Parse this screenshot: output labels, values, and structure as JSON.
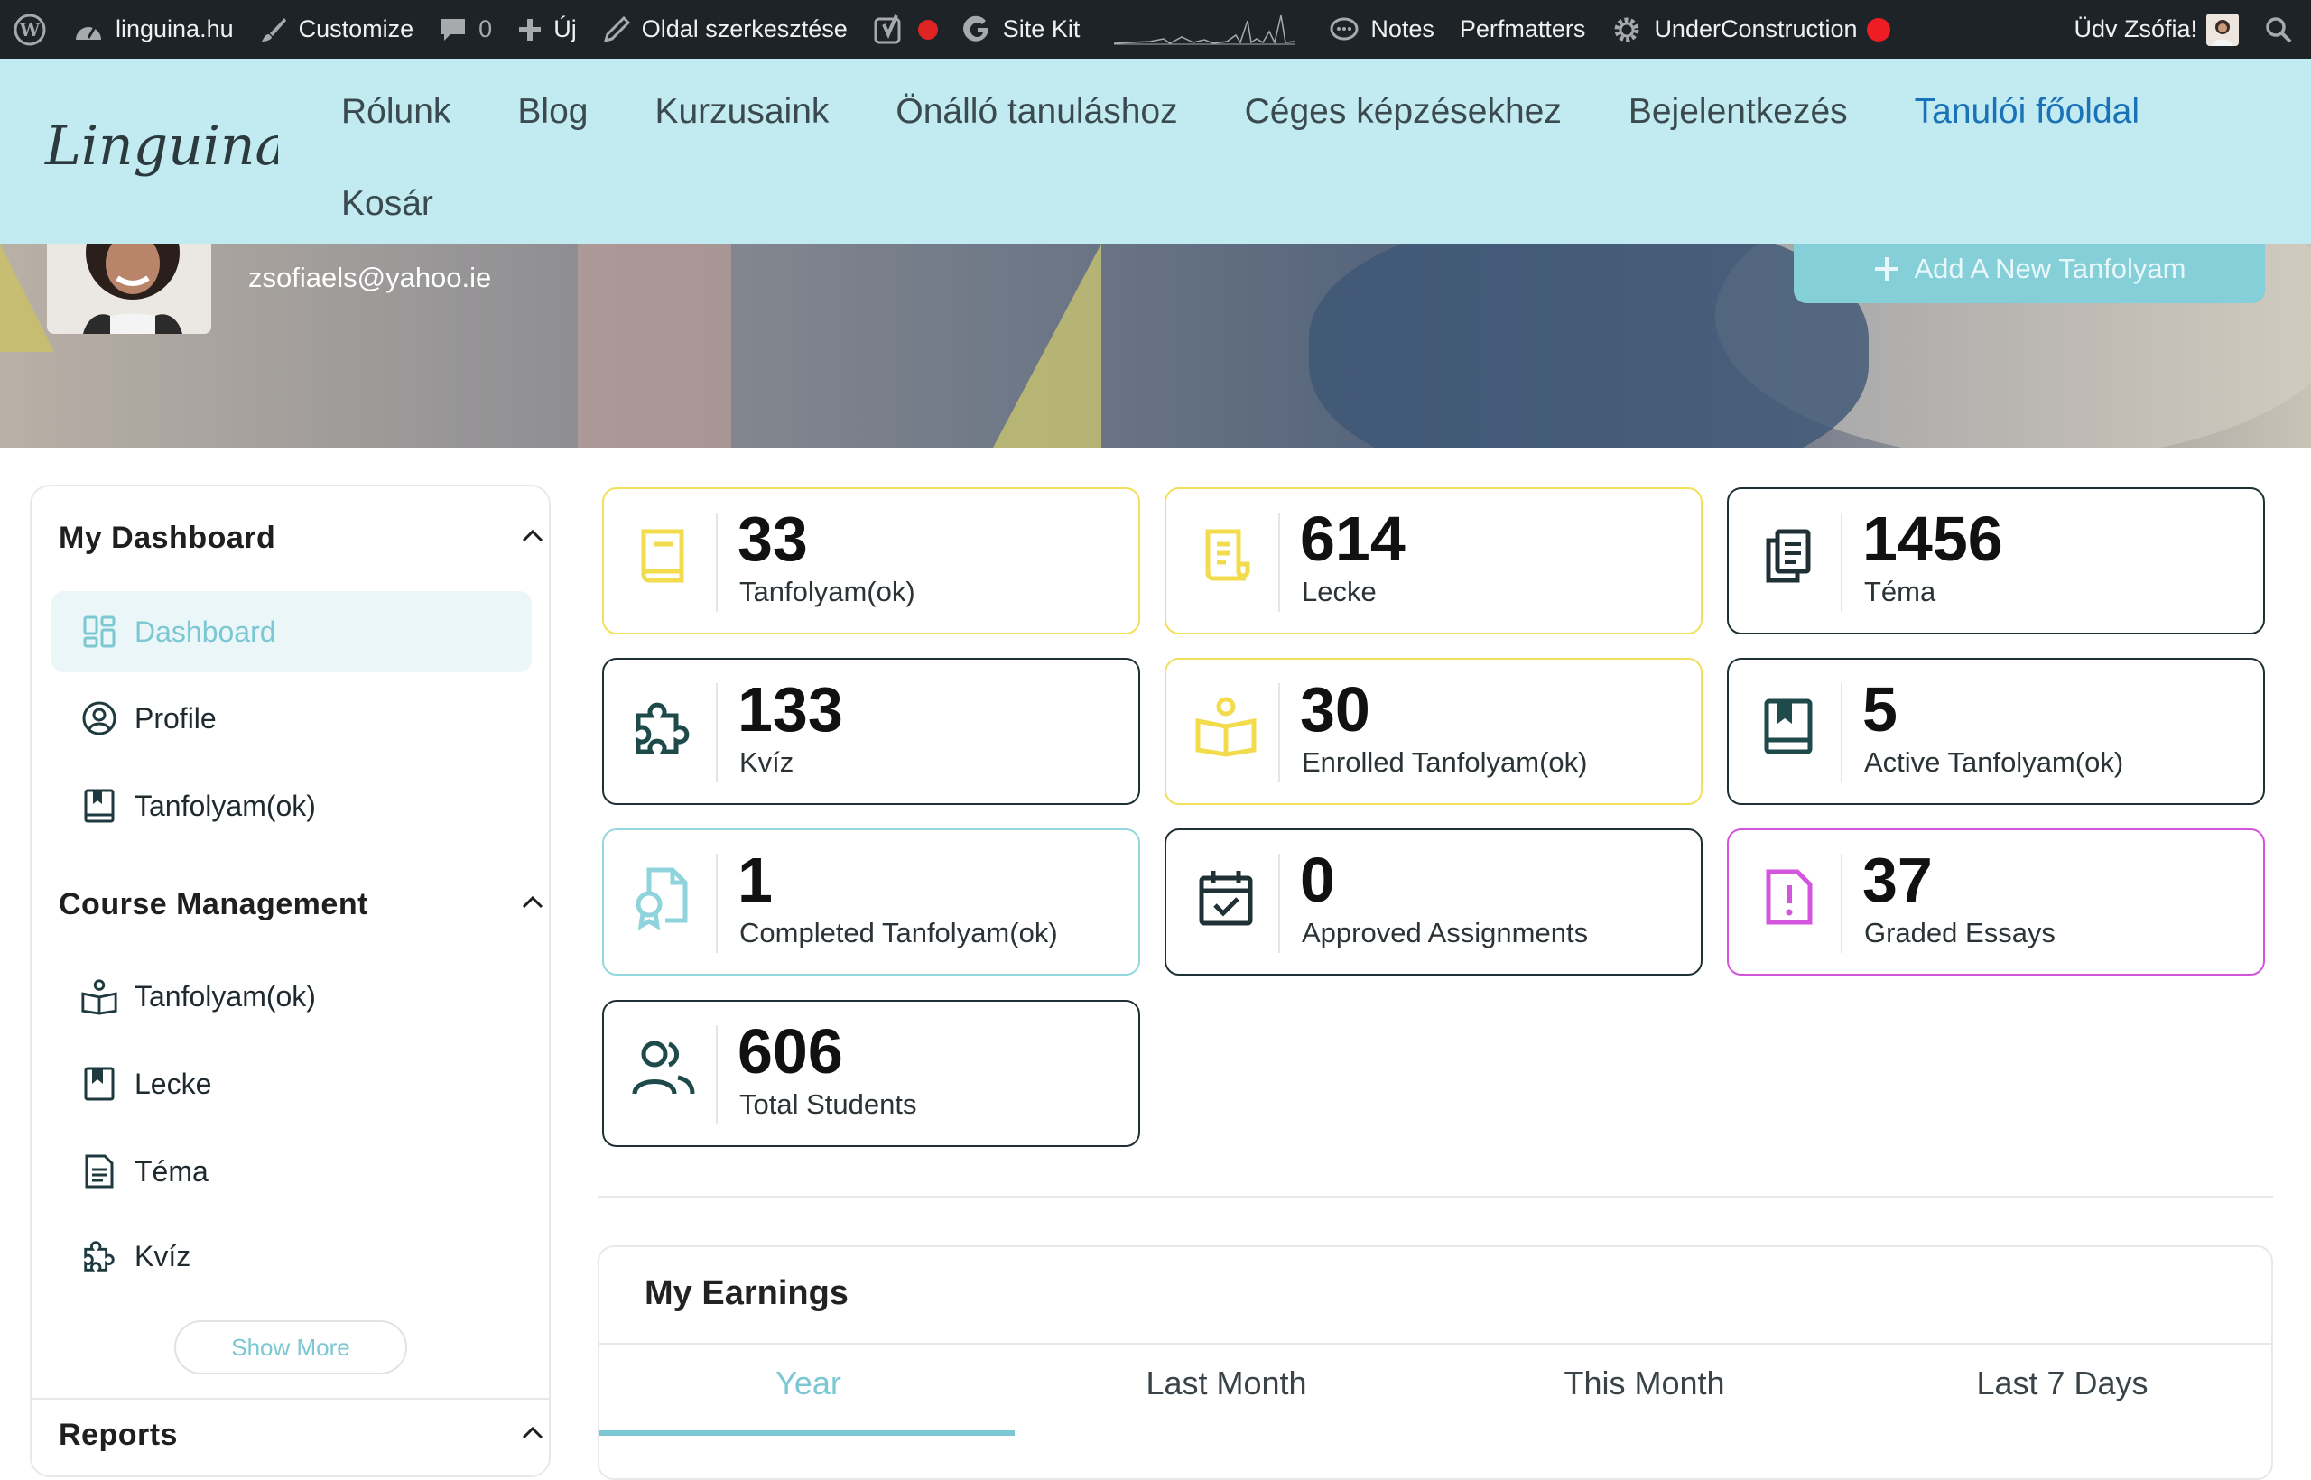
{
  "adminbar": {
    "site": "linguina.hu",
    "customize": "Customize",
    "comments_count": "0",
    "new": "Új",
    "edit_page": "Oldal szerkesztése",
    "site_kit": "Site Kit",
    "notes": "Notes",
    "perfmatters": "Perfmatters",
    "under_construction": "UnderConstruction",
    "greeting": "Üdv Zsófia!"
  },
  "header": {
    "logo_text": "Linguina",
    "nav": [
      "Rólunk",
      "Blog",
      "Kurzusaink",
      "Önálló tanuláshoz",
      "Céges képzésekhez",
      "Bejelentkezés",
      "Tanulói főoldal",
      "Kosár"
    ],
    "active_nav": "Tanulói főoldal"
  },
  "hero": {
    "email": "zsofiaels@yahoo.ie",
    "add_course": "Add A New Tanfolyam"
  },
  "sidebar": {
    "section1": "My Dashboard",
    "items1": [
      {
        "label": "Dashboard",
        "icon": "dashboard-icon",
        "active": true
      },
      {
        "label": "Profile",
        "icon": "profile-icon"
      },
      {
        "label": "Tanfolyam(ok)",
        "icon": "bookmark-book-icon"
      }
    ],
    "section2": "Course Management",
    "items2": [
      {
        "label": "Tanfolyam(ok)",
        "icon": "open-book-icon"
      },
      {
        "label": "Lecke",
        "icon": "bookmark-icon"
      },
      {
        "label": "Téma",
        "icon": "document-icon"
      },
      {
        "label": "Kvíz",
        "icon": "puzzle-icon"
      }
    ],
    "show_more": "Show More",
    "section3": "Reports"
  },
  "stats": [
    {
      "value": "33",
      "label": "Tanfolyam(ok)",
      "icon": "book-icon",
      "color": "#f2e05a"
    },
    {
      "value": "614",
      "label": "Lecke",
      "icon": "document-icon",
      "color": "#f2e05a"
    },
    {
      "value": "1456",
      "label": "Téma",
      "icon": "files-icon",
      "color": "#203135"
    },
    {
      "value": "133",
      "label": "Kvíz",
      "icon": "puzzle-icon",
      "color": "#203135"
    },
    {
      "value": "30",
      "label": "Enrolled Tanfolyam(ok)",
      "icon": "open-book-icon",
      "color": "#f2e05a"
    },
    {
      "value": "5",
      "label": "Active Tanfolyam(ok)",
      "icon": "bookmark-book-icon",
      "color": "#203135"
    },
    {
      "value": "1",
      "label": "Completed Tanfolyam(ok)",
      "icon": "certificate-icon",
      "color": "#95d7df"
    },
    {
      "value": "0",
      "label": "Approved Assignments",
      "icon": "calendar-check-icon",
      "color": "#203135"
    },
    {
      "value": "37",
      "label": "Graded Essays",
      "icon": "alert-file-icon",
      "color": "#d455dd"
    },
    {
      "value": "606",
      "label": "Total Students",
      "icon": "students-icon",
      "color": "#203135"
    }
  ],
  "earnings": {
    "title": "My Earnings",
    "tabs": [
      "Year",
      "Last Month",
      "This Month",
      "Last 7 Days"
    ],
    "active_tab": "Year"
  }
}
